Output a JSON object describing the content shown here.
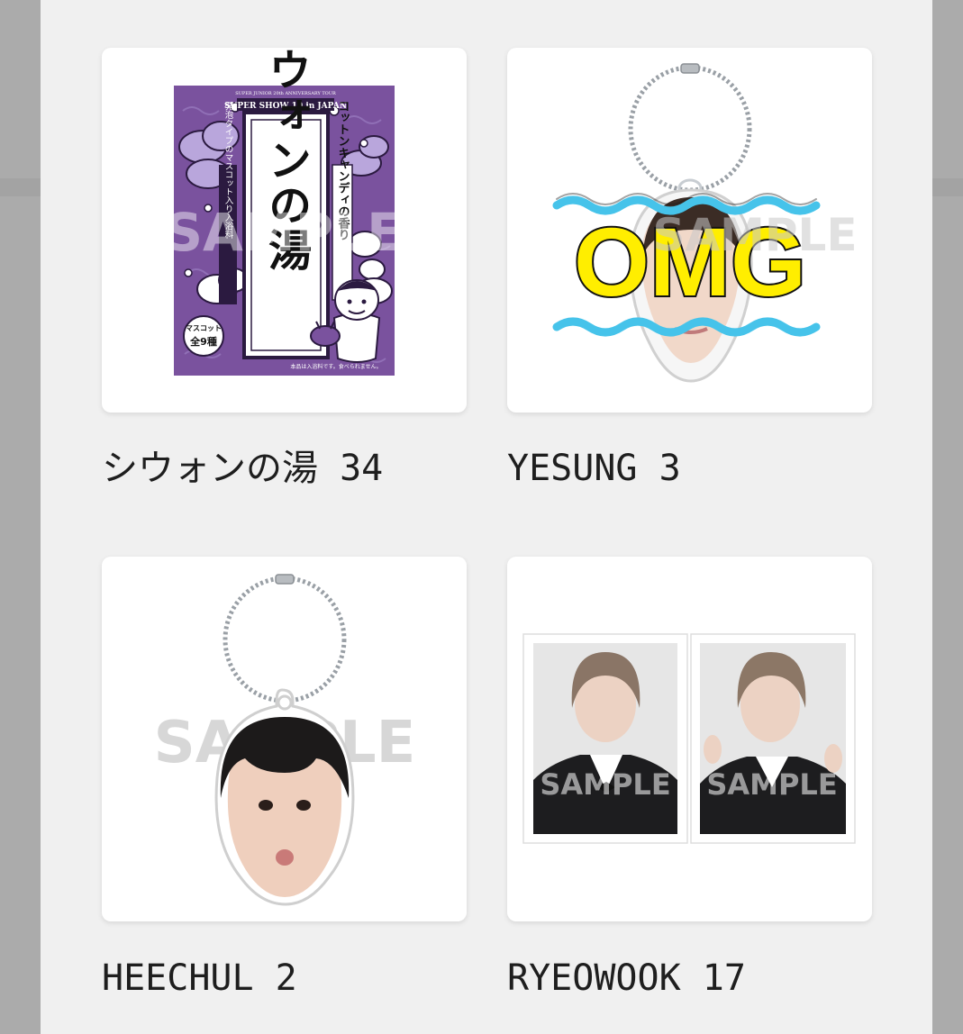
{
  "items": [
    {
      "name": "シウォンの湯",
      "count": "34",
      "image": {
        "watermark": "SAMPLE",
        "band_text": "SUPER SHOW 10 in JAPAN",
        "tiny_band_text": "SUPER JUNIOR 20th ANNIVERSARY TOUR",
        "title_vertical": "シウォンの湯",
        "side_right": "コットンキャンディの香り",
        "side_left": "発泡タイプのマスコット入り入浴料",
        "badge_top": "マスコット",
        "badge_bottom": "全9種",
        "footer": "本品は入浴料です。食べられません。",
        "bg_color": "#7a529e"
      }
    },
    {
      "name": "YESUNG",
      "count": "3",
      "image": {
        "word": "OMG",
        "watermark": "SAMPLE",
        "word_color": "#ffee00",
        "wave_color": "#46c3ea"
      }
    },
    {
      "name": "HEECHUL",
      "count": "2",
      "image": {
        "watermark": "SAMPLE"
      }
    },
    {
      "name": "RYEOWOOK",
      "count": "17",
      "image": {
        "watermark_left": "SAMPLE",
        "watermark_right": "SAMPLE"
      }
    }
  ]
}
